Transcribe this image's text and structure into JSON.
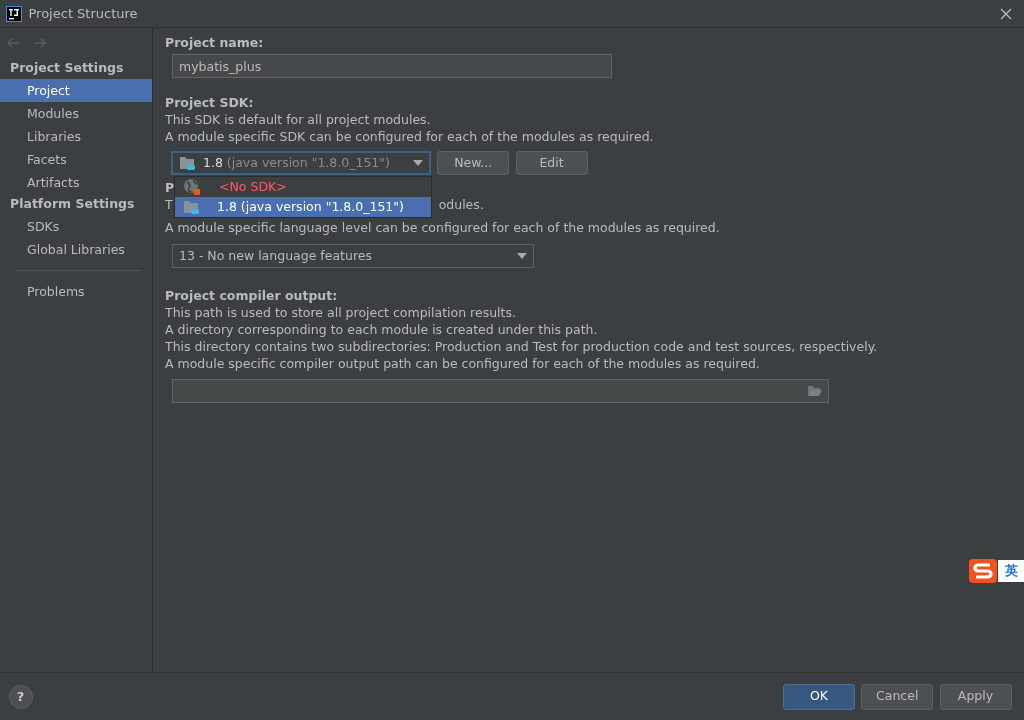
{
  "window": {
    "title": "Project Structure"
  },
  "sidebar": {
    "groups": [
      {
        "title": "Project Settings",
        "items": [
          {
            "label": "Project",
            "selected": true
          },
          {
            "label": "Modules",
            "selected": false
          },
          {
            "label": "Libraries",
            "selected": false
          },
          {
            "label": "Facets",
            "selected": false
          },
          {
            "label": "Artifacts",
            "selected": false
          }
        ]
      },
      {
        "title": "Platform Settings",
        "items": [
          {
            "label": "SDKs",
            "selected": false
          },
          {
            "label": "Global Libraries",
            "selected": false
          }
        ]
      }
    ],
    "extra_items": [
      {
        "label": "Problems",
        "selected": false
      }
    ]
  },
  "project_name": {
    "label": "Project name:",
    "value": "mybatis_plus"
  },
  "project_sdk": {
    "label": "Project SDK:",
    "description": [
      "This SDK is default for all project modules.",
      "A module specific SDK can be configured for each of the modules as required."
    ],
    "dropdown": {
      "version": "1.8",
      "detail": "(java version \"1.8.0_151\")",
      "expanded": true
    },
    "buttons": [
      "New...",
      "Edit"
    ],
    "popup_items": [
      {
        "label": "<No SDK>",
        "kind": "none",
        "selected": false
      },
      {
        "label": "1.8 (java version \"1.8.0_151\")",
        "kind": "jdk",
        "selected": true
      }
    ]
  },
  "language_level": {
    "label_visible": "P",
    "description_first_visible_start": "T",
    "description_first_visible_end": "odules.",
    "description_second": "A module specific language level can be configured for each of the modules as required.",
    "dropdown": "13 - No new language features"
  },
  "compiler_output": {
    "label": "Project compiler output:",
    "description": [
      "This path is used to store all project compilation results.",
      "A directory corresponding to each module is created under this path.",
      "This directory contains two subdirectories: Production and Test for production code and test sources, respectively.",
      "A module specific compiler output path can be configured for each of the modules as required."
    ]
  },
  "footer": {
    "help": "?",
    "buttons": [
      {
        "label": "OK",
        "kind": "primary"
      },
      {
        "label": "Cancel",
        "kind": "default"
      },
      {
        "label": "Apply",
        "kind": "default"
      }
    ]
  },
  "ime": {
    "label": "英"
  }
}
